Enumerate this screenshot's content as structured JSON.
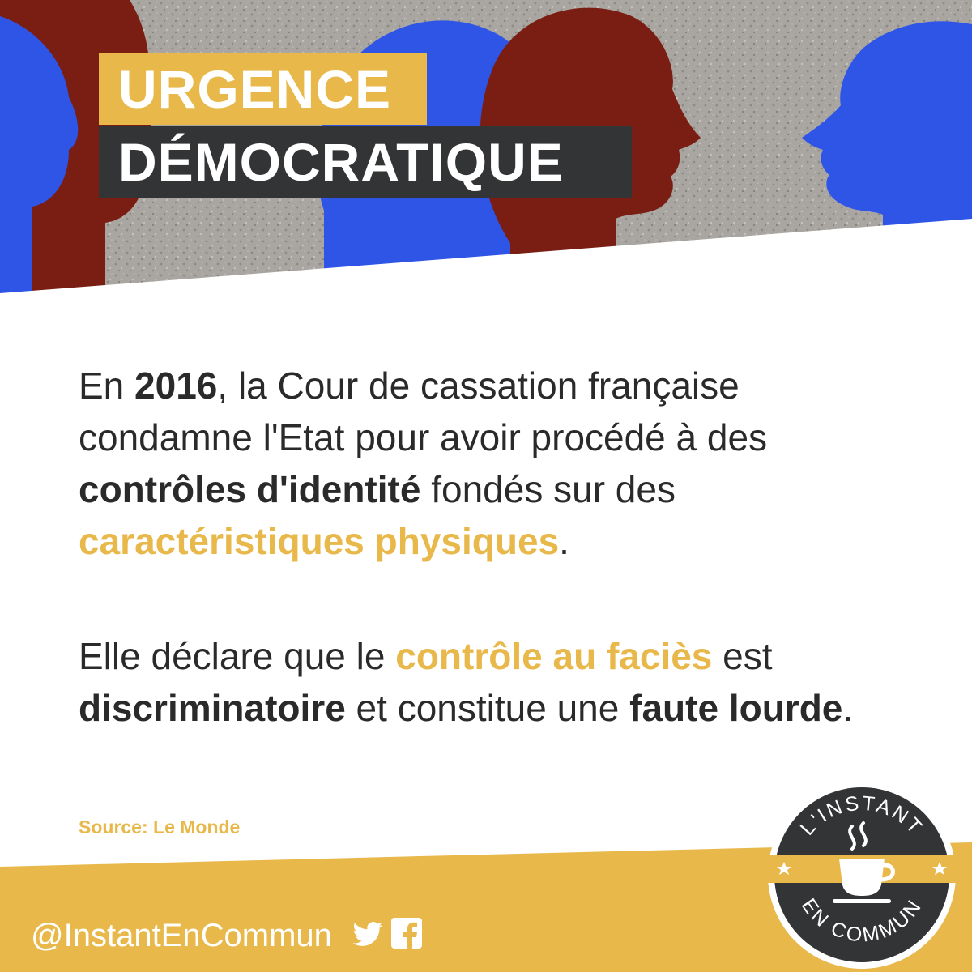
{
  "header": {
    "title_line_1": "URGENCE",
    "title_line_2": "DÉMOCRATIQUE"
  },
  "content": {
    "paragraph_1": {
      "t1": "En ",
      "t2": "2016",
      "t3": ", la Cour de cassation française condamne l'Etat pour avoir procédé à des ",
      "t4": "contrôles d'identité",
      "t5": " fondés sur des ",
      "t6": "caractéristiques physiques",
      "t7": "."
    },
    "paragraph_2": {
      "t1": "Elle déclare que le ",
      "t2": "contrôle au faciès",
      "t3": " est ",
      "t4": "discriminatoire",
      "t5": " et constitue une ",
      "t6": "faute lourde",
      "t7": "."
    },
    "source": "Source: Le Monde"
  },
  "footer": {
    "handle": "@InstantEnCommun",
    "icons": [
      "twitter-icon",
      "facebook-icon"
    ]
  },
  "logo": {
    "top_text": "L'INSTANT",
    "bottom_text": "EN COMMUN",
    "icon": "coffee-cup-icon"
  },
  "colors": {
    "accent_gold": "#e8b84a",
    "dark": "#323436",
    "profile_blue": "#2f55e6",
    "profile_red": "#7a1e14",
    "stone_grey": "#a9a6a2"
  }
}
